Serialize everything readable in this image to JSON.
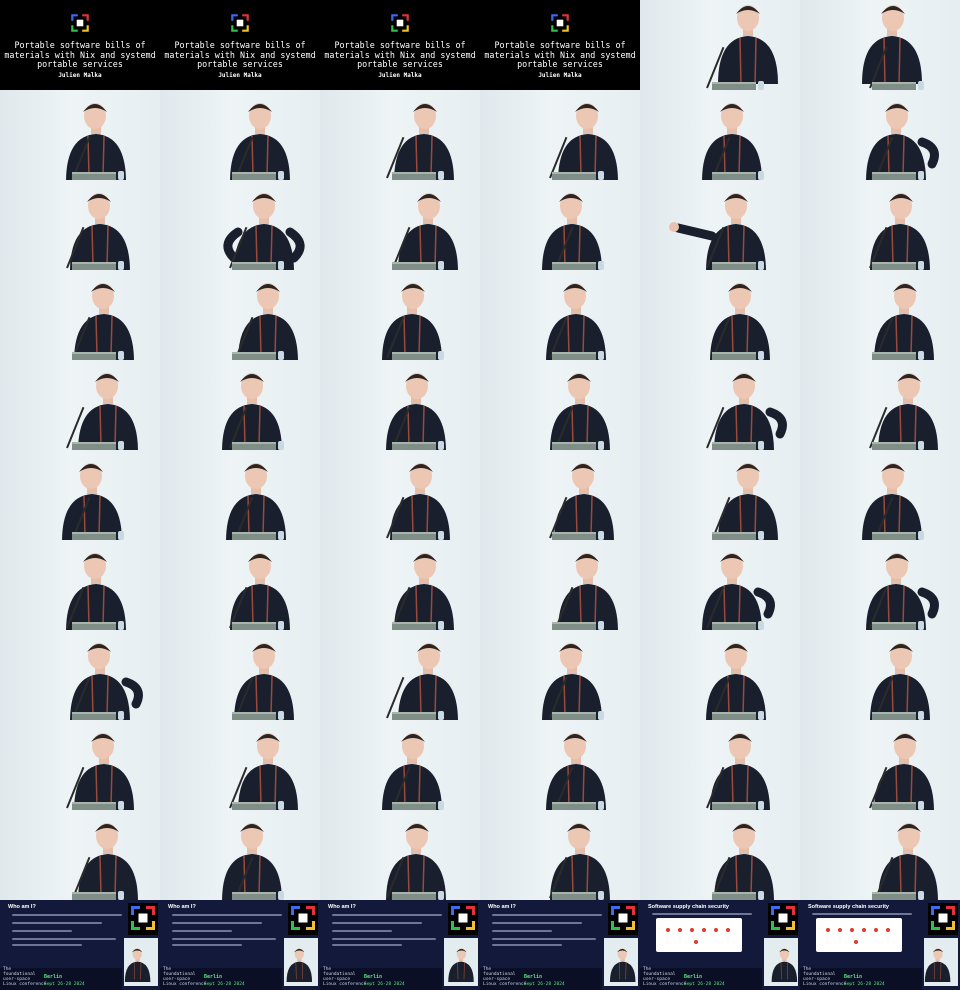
{
  "talk": {
    "title": "Portable software bills of materials with Nix and systemd portable services",
    "author": "Julien Malka"
  },
  "conference": {
    "name_lines": "The\nfoundational\nuser-space\nLinux conference",
    "city": "Berlin",
    "dates": "Sept 26-28 2024"
  },
  "slides": {
    "who_am_i": "Who am I?",
    "supply_chain": "Software supply chain security"
  },
  "colors": {
    "title_bg": "#000000",
    "slide_bg": "#13193a",
    "accent_green": "#5fe07a",
    "backdrop": "#e6eef1",
    "jacket": "#1a1f2e"
  },
  "frames": [
    {
      "type": "title"
    },
    {
      "type": "title"
    },
    {
      "type": "title"
    },
    {
      "type": "title"
    },
    {
      "type": "speaker",
      "pose": "up"
    },
    {
      "type": "speaker",
      "pose": "up"
    },
    {
      "type": "speaker"
    },
    {
      "type": "speaker"
    },
    {
      "type": "speaker"
    },
    {
      "type": "speaker"
    },
    {
      "type": "speaker"
    },
    {
      "type": "speaker",
      "pose": "hand-hip"
    },
    {
      "type": "speaker"
    },
    {
      "type": "speaker",
      "pose": "arms-out"
    },
    {
      "type": "speaker"
    },
    {
      "type": "speaker"
    },
    {
      "type": "speaker",
      "pose": "arm-extend"
    },
    {
      "type": "speaker"
    },
    {
      "type": "speaker"
    },
    {
      "type": "speaker"
    },
    {
      "type": "speaker"
    },
    {
      "type": "speaker"
    },
    {
      "type": "speaker"
    },
    {
      "type": "speaker"
    },
    {
      "type": "speaker"
    },
    {
      "type": "speaker"
    },
    {
      "type": "speaker"
    },
    {
      "type": "speaker"
    },
    {
      "type": "speaker",
      "pose": "hand-hip"
    },
    {
      "type": "speaker"
    },
    {
      "type": "speaker"
    },
    {
      "type": "speaker"
    },
    {
      "type": "speaker"
    },
    {
      "type": "speaker"
    },
    {
      "type": "speaker"
    },
    {
      "type": "speaker"
    },
    {
      "type": "speaker"
    },
    {
      "type": "speaker"
    },
    {
      "type": "speaker"
    },
    {
      "type": "speaker"
    },
    {
      "type": "speaker",
      "pose": "hand-hip"
    },
    {
      "type": "speaker",
      "pose": "hand-hip"
    },
    {
      "type": "speaker",
      "pose": "hand-hip"
    },
    {
      "type": "speaker"
    },
    {
      "type": "speaker"
    },
    {
      "type": "speaker"
    },
    {
      "type": "speaker"
    },
    {
      "type": "speaker"
    },
    {
      "type": "speaker"
    },
    {
      "type": "speaker"
    },
    {
      "type": "speaker"
    },
    {
      "type": "speaker"
    },
    {
      "type": "speaker"
    },
    {
      "type": "speaker"
    },
    {
      "type": "speaker"
    },
    {
      "type": "speaker"
    },
    {
      "type": "speaker"
    },
    {
      "type": "speaker"
    },
    {
      "type": "speaker"
    },
    {
      "type": "speaker"
    },
    {
      "type": "slide",
      "slide": "who_am_i"
    },
    {
      "type": "slide",
      "slide": "who_am_i"
    },
    {
      "type": "slide",
      "slide": "who_am_i"
    },
    {
      "type": "slide",
      "slide": "who_am_i"
    },
    {
      "type": "slide",
      "slide": "supply_chain"
    },
    {
      "type": "slide",
      "slide": "supply_chain"
    }
  ]
}
